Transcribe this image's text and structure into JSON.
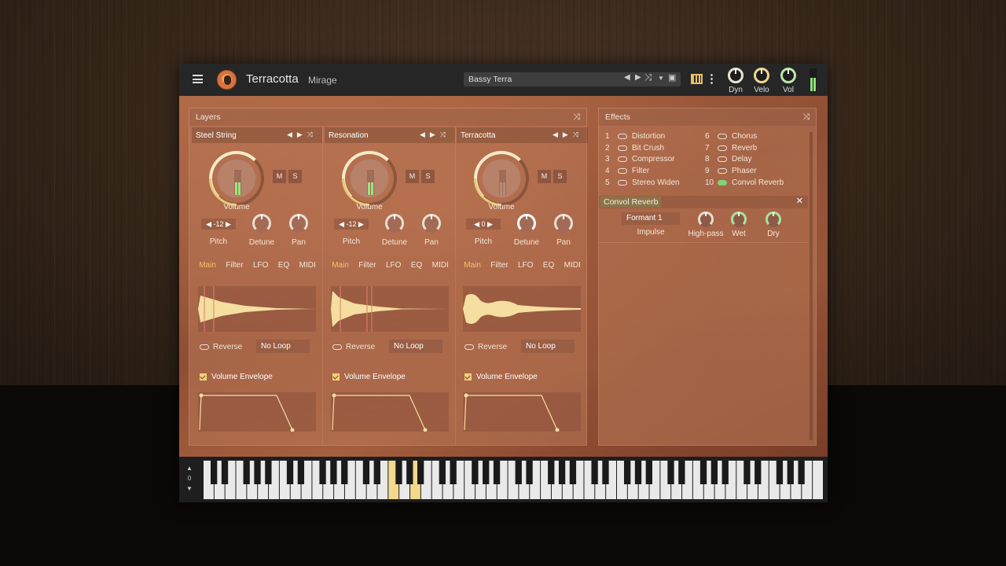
{
  "app": {
    "title": "Terracotta",
    "subtitle": "Mirage"
  },
  "preset": {
    "name": "Bassy Terra"
  },
  "top_knobs": [
    {
      "label": "Dyn"
    },
    {
      "label": "Velo"
    },
    {
      "label": "Vol"
    }
  ],
  "layers": {
    "title": "Layers",
    "columns": [
      {
        "name": "Steel String",
        "volume_label": "Volume",
        "pitch": "-12",
        "pitch_label": "Pitch",
        "detune_label": "Detune",
        "pan_label": "Pan",
        "tabs": [
          "Main",
          "Filter",
          "LFO",
          "EQ",
          "MIDI"
        ],
        "reverse_label": "Reverse",
        "loop": "No Loop",
        "envelope_label": "Volume Envelope"
      },
      {
        "name": "Resonation",
        "volume_label": "Volume",
        "pitch": "-12",
        "pitch_label": "Pitch",
        "detune_label": "Detune",
        "pan_label": "Pan",
        "tabs": [
          "Main",
          "Filter",
          "LFO",
          "EQ",
          "MIDI"
        ],
        "reverse_label": "Reverse",
        "loop": "No Loop",
        "envelope_label": "Volume Envelope"
      },
      {
        "name": "Terracotta",
        "volume_label": "Volume",
        "pitch": "0",
        "pitch_label": "Pitch",
        "detune_label": "Detune",
        "pan_label": "Pan",
        "tabs": [
          "Main",
          "Filter",
          "LFO",
          "EQ",
          "MIDI"
        ],
        "reverse_label": "Reverse",
        "loop": "No Loop",
        "envelope_label": "Volume Envelope"
      }
    ],
    "ms": {
      "m": "M",
      "s": "S"
    }
  },
  "effects": {
    "title": "Effects",
    "left": [
      {
        "n": "1",
        "name": "Distortion"
      },
      {
        "n": "2",
        "name": "Bit Crush"
      },
      {
        "n": "3",
        "name": "Compressor"
      },
      {
        "n": "4",
        "name": "Filter"
      },
      {
        "n": "5",
        "name": "Stereo Widen"
      }
    ],
    "right": [
      {
        "n": "6",
        "name": "Chorus"
      },
      {
        "n": "7",
        "name": "Reverb"
      },
      {
        "n": "8",
        "name": "Delay"
      },
      {
        "n": "9",
        "name": "Phaser"
      },
      {
        "n": "10",
        "name": "Convol Reverb"
      }
    ],
    "active": {
      "name": "Convol Reverb",
      "impulse_value": "Formant 1",
      "impulse_label": "Impulse",
      "highpass_label": "High-pass",
      "wet_label": "Wet",
      "dry_label": "Dry"
    }
  },
  "keyboard": {
    "octave": "0"
  },
  "colors": {
    "accent": "#f3c16e",
    "meter": "#8fe07a",
    "toggle_on": "#7fd27a"
  }
}
